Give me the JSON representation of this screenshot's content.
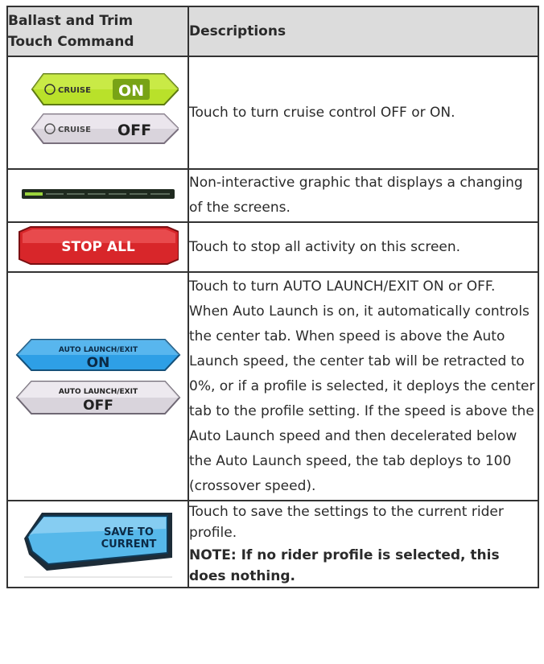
{
  "table": {
    "header": {
      "command_line1": "Ballast and Trim",
      "command_line2": "Touch Command",
      "descriptions": "Descriptions"
    },
    "rows": [
      {
        "icons": {
          "on_small": "CRUISE",
          "on_big": "ON",
          "off_small": "CRUISE",
          "off_big": "OFF",
          "icon": "gauge-icon"
        },
        "description": "Touch to turn cruise control OFF or ON."
      },
      {
        "description": "Non-interactive graphic that displays a changing of the screens."
      },
      {
        "icons": {
          "label": "STOP ALL"
        },
        "description": "Touch to stop all activity on this screen."
      },
      {
        "icons": {
          "on_small": "AUTO LAUNCH/EXIT",
          "on_big": "ON",
          "off_small": "AUTO LAUNCH/EXIT",
          "off_big": "OFF"
        },
        "description": "Touch to turn AUTO LAUNCH/EXIT ON or OFF. When Auto Launch is on, it automatically controls the center tab. When speed is above the Auto Launch speed, the center tab will be retracted to 0%, or if a profile is selected, it deploys the center tab to the profile setting. If the speed is above the Auto Launch speed and then decelerated below the Auto Launch speed, the tab deploys to 100 (crossover speed)."
      },
      {
        "icons": {
          "line1": "SAVE TO",
          "line2": "CURRENT"
        },
        "description": "Touch to save the settings to the current rider profile.",
        "note": "NOTE: If no rider profile is selected, this does nothing."
      }
    ]
  },
  "colors": {
    "header_bg": "#dcdcdc",
    "border": "#333333",
    "cruise_on": "#b9e12a",
    "cruise_off": "#d9d4dc",
    "stop_red": "#d8262a",
    "auto_blue": "#2e9fe6",
    "save_blue": "#56b8ea",
    "progress_green": "#9ad43c"
  }
}
